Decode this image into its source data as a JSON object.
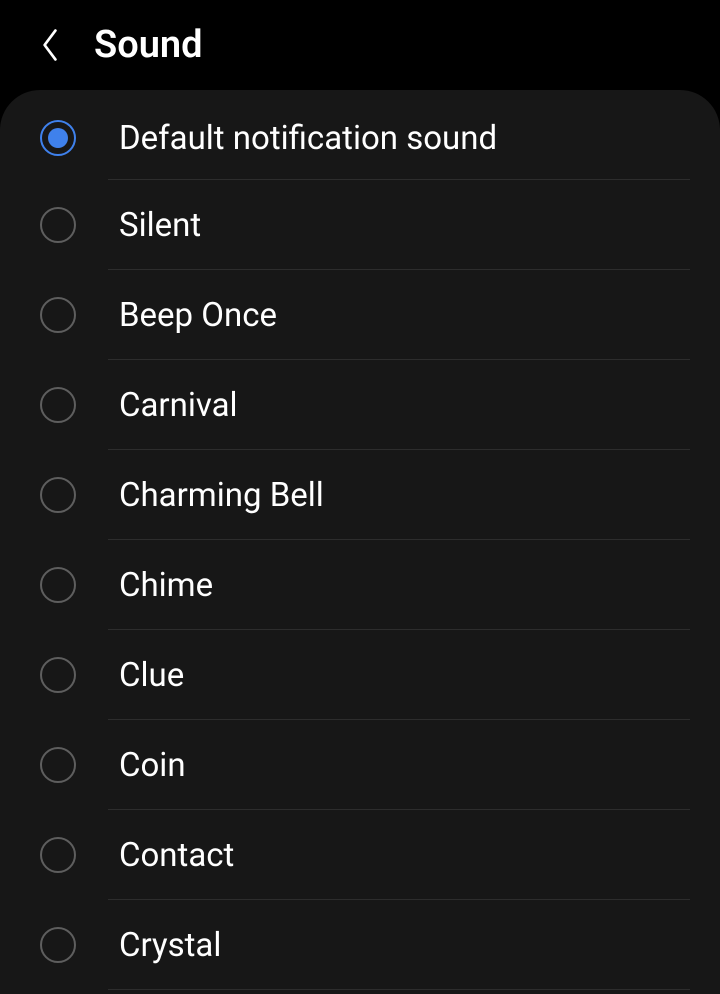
{
  "header": {
    "title": "Sound"
  },
  "sounds": [
    {
      "label": "Default notification sound",
      "selected": true
    },
    {
      "label": "Silent",
      "selected": false
    },
    {
      "label": "Beep Once",
      "selected": false
    },
    {
      "label": "Carnival",
      "selected": false
    },
    {
      "label": "Charming Bell",
      "selected": false
    },
    {
      "label": "Chime",
      "selected": false
    },
    {
      "label": "Clue",
      "selected": false
    },
    {
      "label": "Coin",
      "selected": false
    },
    {
      "label": "Contact",
      "selected": false
    },
    {
      "label": "Crystal",
      "selected": false
    }
  ]
}
